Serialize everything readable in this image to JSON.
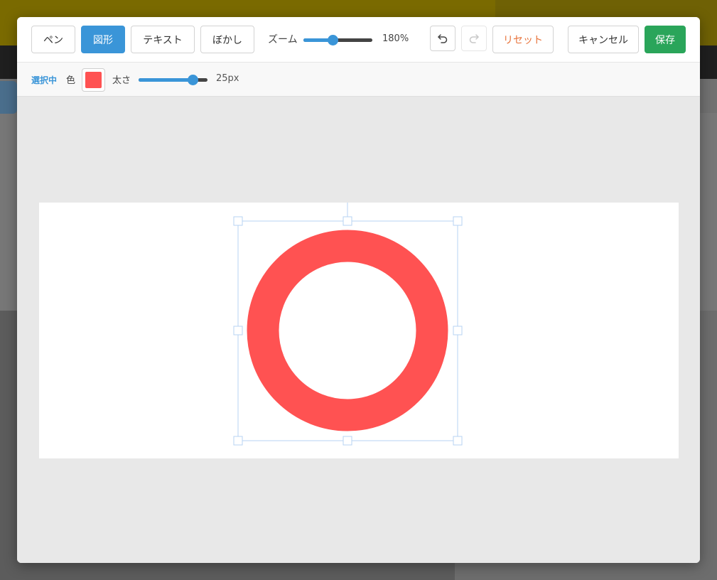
{
  "toolbar": {
    "tools": [
      {
        "id": "pen",
        "label": "ペン",
        "active": false
      },
      {
        "id": "shape",
        "label": "図形",
        "active": true
      },
      {
        "id": "text",
        "label": "テキスト",
        "active": false
      },
      {
        "id": "blur",
        "label": "ぼかし",
        "active": false
      }
    ],
    "zoom_label": "ズーム",
    "zoom_value": "180%",
    "zoom_level": 0.42,
    "undo_icon": "undo-icon",
    "redo_icon": "redo-icon",
    "reset_label": "リセット",
    "cancel_label": "キャンセル",
    "save_label": "保存"
  },
  "subbar": {
    "status": "選択中",
    "color_label": "色",
    "color_value": "#ff5252",
    "thickness_label": "太さ",
    "thickness_value": "25px",
    "thickness_level": 0.78
  },
  "colors": {
    "accent": "#3a95d8",
    "save": "#2aa55a",
    "reset": "#e8733b",
    "shape_stroke": "#ff5252",
    "selection": "#b7d3f3"
  },
  "shape": {
    "type": "circle",
    "selected": true
  }
}
